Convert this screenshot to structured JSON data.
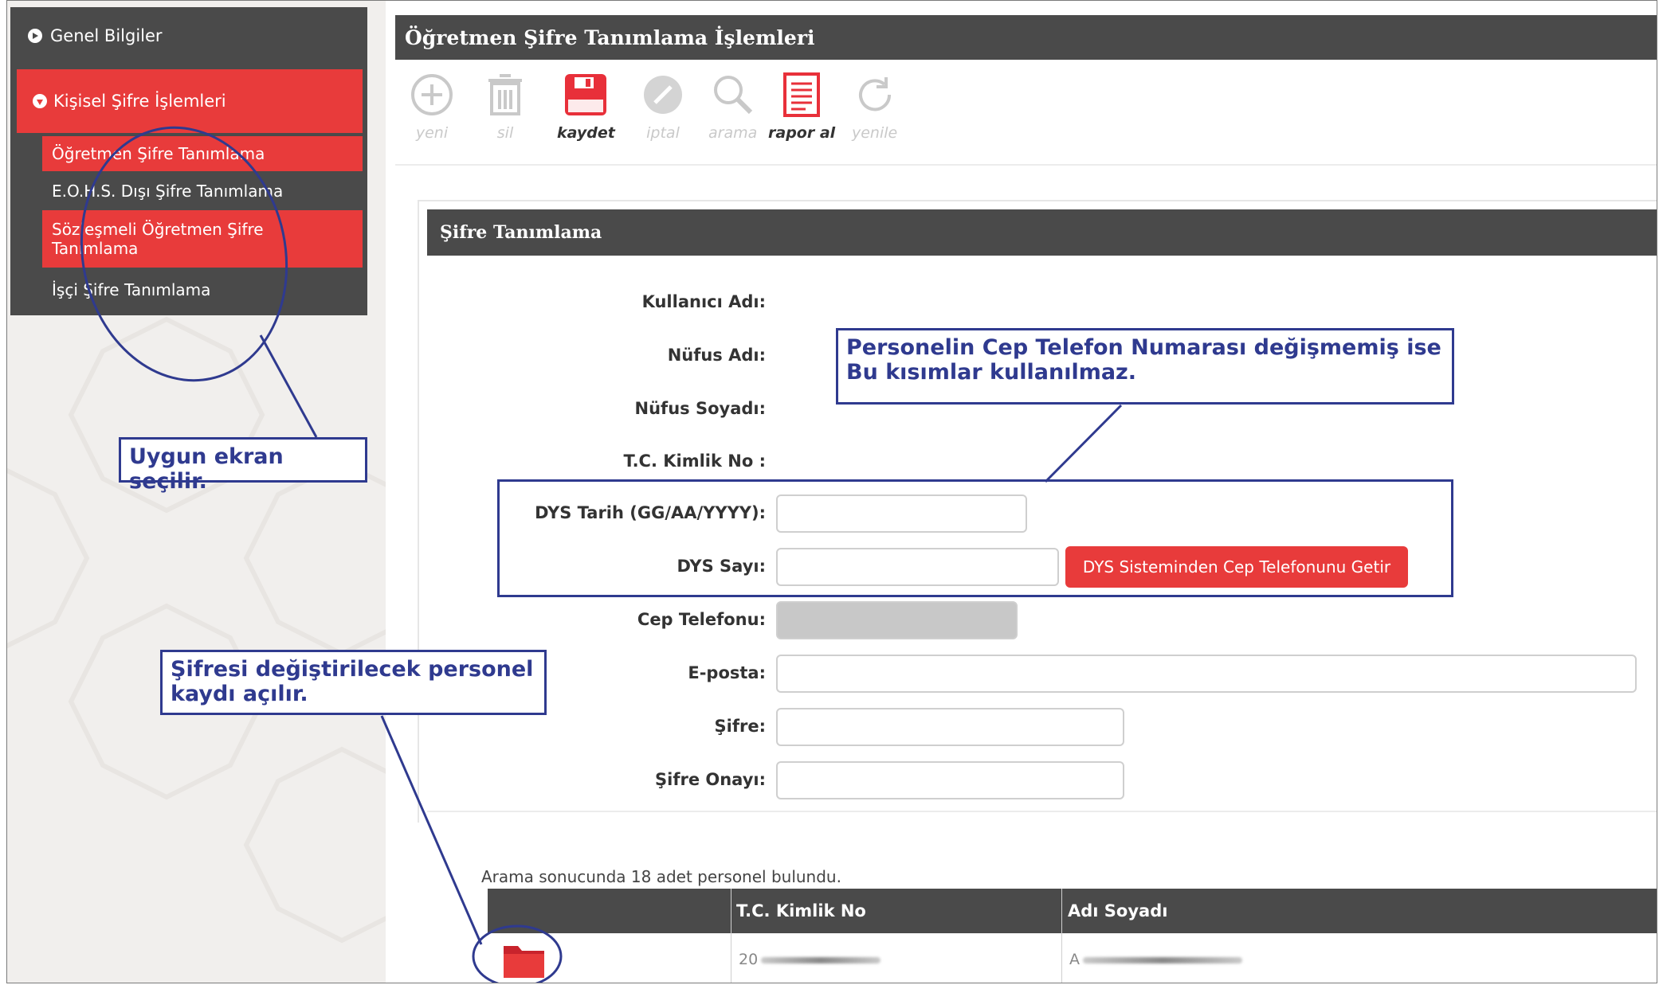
{
  "sidebar": {
    "top_item": "Genel Bilgiler",
    "menu_head": "Kişisel Şifre İşlemleri",
    "items": [
      {
        "label": "Öğretmen Şifre Tanımlama"
      },
      {
        "label": "E.O.H.S. Dışı Şifre Tanımlama"
      },
      {
        "label": "Sözleşmeli Öğretmen Şifre Tanımlama"
      },
      {
        "label": "İşçi Şifre Tanımlama"
      }
    ]
  },
  "header": {
    "title": "Öğretmen Şifre Tanımlama İşlemleri"
  },
  "toolbar": {
    "yeni": "yeni",
    "sil": "sil",
    "kaydet": "kaydet",
    "iptal": "iptal",
    "arama": "arama",
    "rapor": "rapor al",
    "yenile": "yenile"
  },
  "form": {
    "panel_title": "Şifre Tanımlama",
    "labels": {
      "kullanici": "Kullanıcı Adı:",
      "nufus_adi": "Nüfus Adı:",
      "nufus_soyadi": "Nüfus Soyadı:",
      "tc": "T.C. Kimlik No :",
      "dys_tarih": "DYS Tarih (GG/AA/YYYY):",
      "dys_sayi": "DYS Sayı:",
      "cep": "Cep Telefonu:",
      "eposta": "E-posta:",
      "sifre": "Şifre:",
      "sifre_onay": "Şifre Onayı:"
    },
    "dys_button": "DYS Sisteminden Cep Telefonunu Getir"
  },
  "results": {
    "info": "Arama sonucunda 18 adet personel bulundu.",
    "columns": [
      "T.C. Kimlik No",
      "Adı Soyadı"
    ],
    "row": {
      "tc": "20",
      "ad": "A"
    }
  },
  "callouts": {
    "screen": "Uygun ekran seçilir.",
    "dys": "Personelin Cep Telefon Numarası değişmemiş ise Bu kısımlar kullanılmaz.",
    "record": "Şifresi değiştirilecek personel kaydı açılır."
  },
  "colors": {
    "accent_red": "#e83b3b",
    "dark_gray": "#4a4a4a",
    "callout_blue": "#2f3a8f"
  }
}
